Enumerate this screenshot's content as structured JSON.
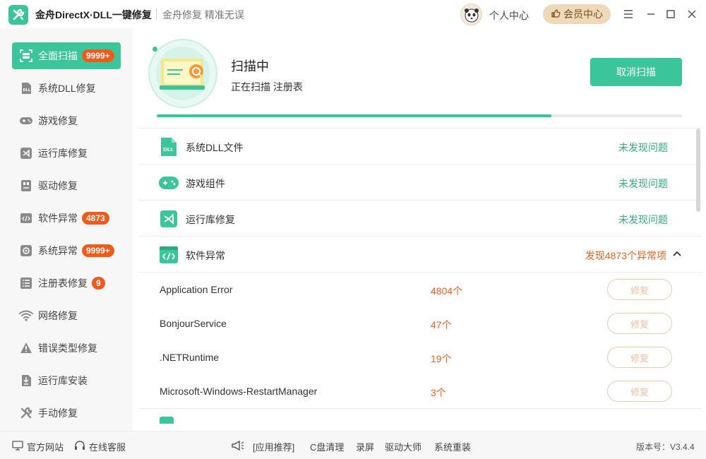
{
  "window": {
    "title": "金舟DirectX·DLL一键修复",
    "slogan": "金舟修复 精准无误",
    "user_center": "个人中心",
    "vip_center": "会员中心"
  },
  "sidebar": {
    "items": [
      {
        "label": "全面扫描",
        "badge": "9999+",
        "icon": "scan-icon"
      },
      {
        "label": "系统DLL修复",
        "badge": "",
        "icon": "dll-icon"
      },
      {
        "label": "游戏修复",
        "badge": "",
        "icon": "gamepad-icon"
      },
      {
        "label": "运行库修复",
        "badge": "",
        "icon": "runtime-icon"
      },
      {
        "label": "驱动修复",
        "badge": "",
        "icon": "driver-icon"
      },
      {
        "label": "软件异常",
        "badge": "4873",
        "icon": "code-icon"
      },
      {
        "label": "系统异常",
        "badge": "9999+",
        "icon": "gear-icon"
      },
      {
        "label": "注册表修复",
        "badge": "9",
        "icon": "list-icon"
      },
      {
        "label": "网络修复",
        "badge": "",
        "icon": "wifi-icon"
      },
      {
        "label": "错误类型修复",
        "badge": "",
        "icon": "warning-icon"
      },
      {
        "label": "运行库安装",
        "badge": "",
        "icon": "install-icon"
      },
      {
        "label": "手动修复",
        "badge": "",
        "icon": "wrench-icon"
      }
    ]
  },
  "scan": {
    "title": "扫描中",
    "status": "正在扫描 注册表",
    "cancel_label": "取消扫描",
    "progress": 0.752
  },
  "categories": [
    {
      "label": "系统DLL文件",
      "status": "未发现问题",
      "icon": "dll-file-icon"
    },
    {
      "label": "游戏组件",
      "status": "未发现问题",
      "icon": "gamepad-icon"
    },
    {
      "label": "运行库修复",
      "status": "未发现问题",
      "icon": "runtime-icon"
    },
    {
      "label": "软件异常",
      "status": "发现4873个异常项",
      "icon": "code-icon"
    }
  ],
  "issues": [
    {
      "name": "Application Error",
      "count": "4804个",
      "action": "修复"
    },
    {
      "name": "BonjourService",
      "count": "47个",
      "action": "修复"
    },
    {
      "name": ".NETRuntime",
      "count": "19个",
      "action": "修复"
    },
    {
      "name": "Microsoft-Windows-RestartManager",
      "count": "3个",
      "action": "修复"
    }
  ],
  "bottom": {
    "official_site": "官方网站",
    "online_service": "在线客服",
    "links": [
      "[应用推荐]",
      "C盘清理",
      "录屏",
      "驱动大师",
      "系统重装"
    ],
    "version": "版本号：V3.4.4"
  },
  "colors": {
    "accent": "#3cc49a",
    "badge": "#f05a1a",
    "warning_text": "#e5631f",
    "ok_text": "#3aa882"
  }
}
